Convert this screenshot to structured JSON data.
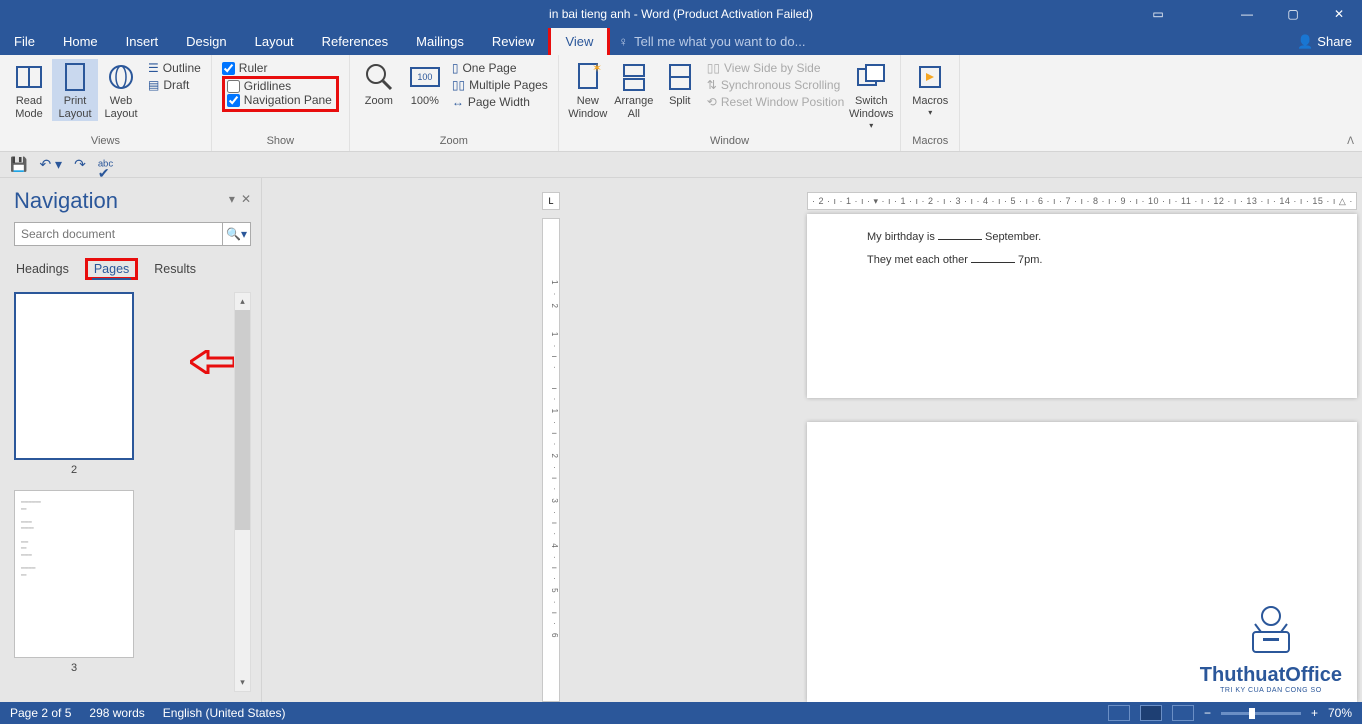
{
  "title": "in bai tieng anh - Word (Product Activation Failed)",
  "menu": {
    "file": "File",
    "home": "Home",
    "insert": "Insert",
    "design": "Design",
    "layout": "Layout",
    "references": "References",
    "mailings": "Mailings",
    "review": "Review",
    "view": "View",
    "tell": "Tell me what you want to do...",
    "share": "Share"
  },
  "ribbon": {
    "views": {
      "label": "Views",
      "read": "Read\nMode",
      "print": "Print\nLayout",
      "web": "Web\nLayout",
      "outline": "Outline",
      "draft": "Draft"
    },
    "show": {
      "label": "Show",
      "ruler": "Ruler",
      "gridlines": "Gridlines",
      "navpane": "Navigation Pane"
    },
    "zoom": {
      "label": "Zoom",
      "zoom": "Zoom",
      "hundred": "100%",
      "one": "One Page",
      "multi": "Multiple Pages",
      "width": "Page Width"
    },
    "window": {
      "label": "Window",
      "new": "New\nWindow",
      "arrange": "Arrange\nAll",
      "split": "Split",
      "side": "View Side by Side",
      "sync": "Synchronous Scrolling",
      "reset": "Reset Window Position",
      "switch": "Switch\nWindows"
    },
    "macros": {
      "label": "Macros",
      "macros": "Macros"
    }
  },
  "nav": {
    "title": "Navigation",
    "search_ph": "Search document",
    "headings": "Headings",
    "pages": "Pages",
    "results": "Results",
    "thumb2": "2",
    "thumb3": "3"
  },
  "doc": {
    "line1a": "My birthday is",
    "line1b": "September.",
    "line2a": "They met each other",
    "line2b": "7pm."
  },
  "status": {
    "page": "Page 2 of 5",
    "words": "298 words",
    "lang": "English (United States)",
    "zoom": "70%"
  },
  "watermark": {
    "name": "ThuthuatOffice",
    "tag": "TRI KY CUA DAN CONG SO"
  }
}
